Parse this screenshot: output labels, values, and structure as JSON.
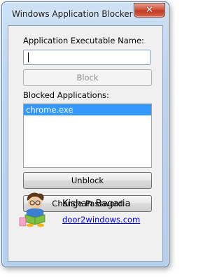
{
  "window": {
    "title": "Windows Application Blocker"
  },
  "form": {
    "exe_label": "Application Executable Name:",
    "exe_value": "",
    "block_button": "Block",
    "blocked_label": "Blocked Applications:",
    "blocked_apps": [
      "chrome.exe"
    ],
    "unblock_button": "Unblock",
    "change_password_button": "Change Password"
  },
  "author": {
    "name": "Kishan Bagaria",
    "link": "door2windows.com"
  },
  "icons": {
    "close": "close-icon",
    "mascot": "mascot-reading-icon"
  },
  "colors": {
    "selection": "#3399ff",
    "link": "#0000ee",
    "close_button": "#c03a22"
  }
}
